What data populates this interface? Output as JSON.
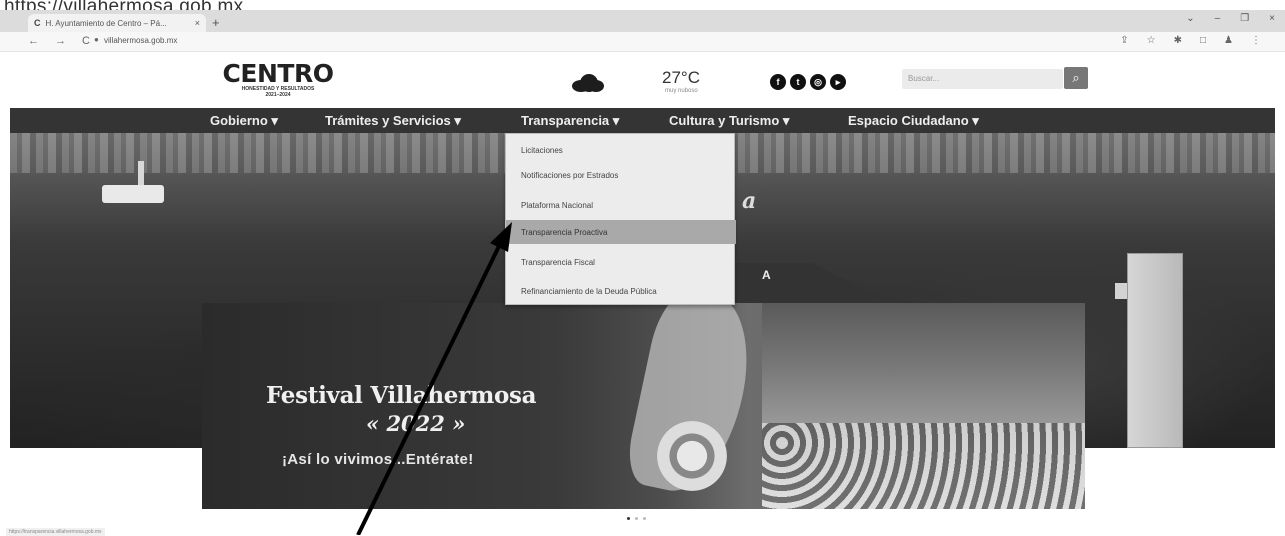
{
  "caption": {
    "url": "https://villahermosa.gob.mx"
  },
  "browser": {
    "tab_title": "H. Ayuntamiento de Centro – Pá...",
    "tab_close": "×",
    "new_tab": "+",
    "window_controls": [
      "⌄",
      "–",
      "❐",
      "×"
    ],
    "url": "villahermosa.gob.mx",
    "status_url": "https://transparencia.villahermosa.gob.mx"
  },
  "header": {
    "logo_main": "CENTRO",
    "logo_sub": "HONESTIDAD Y RESULTADOS",
    "logo_years": "2021–2024",
    "weather_temp": "27°C",
    "weather_desc": "muy nuboso",
    "social_icons": [
      "facebook-icon",
      "twitter-icon",
      "instagram-icon",
      "youtube-icon"
    ],
    "search_placeholder": "Buscar..."
  },
  "nav": {
    "items": [
      {
        "label": "Gobierno"
      },
      {
        "label": "Trámites y Servicios"
      },
      {
        "label": "Transparencia"
      },
      {
        "label": "Cultura y Turismo"
      },
      {
        "label": "Espacio Ciudadano"
      }
    ],
    "caret": "▾"
  },
  "dropdown": {
    "items": [
      {
        "label": "Licitaciones"
      },
      {
        "label": "Notificaciones por Estrados"
      },
      {
        "label": "Plataforma Nacional"
      },
      {
        "label": "Transparencia Proactiva"
      },
      {
        "label": "Transparencia Fiscal"
      },
      {
        "label": "Refinanciamiento de la Deuda Pública"
      }
    ],
    "highlighted_index": 3
  },
  "hero": {
    "script_text": "a",
    "letter": "A",
    "prev_label": "‹"
  },
  "banner": {
    "title": "Festival Villahermosa",
    "year": "2022",
    "tagline": "¡Así lo vivimos...Entérate!"
  },
  "carousel": {
    "active_slide": 1,
    "total_slides": 3
  }
}
